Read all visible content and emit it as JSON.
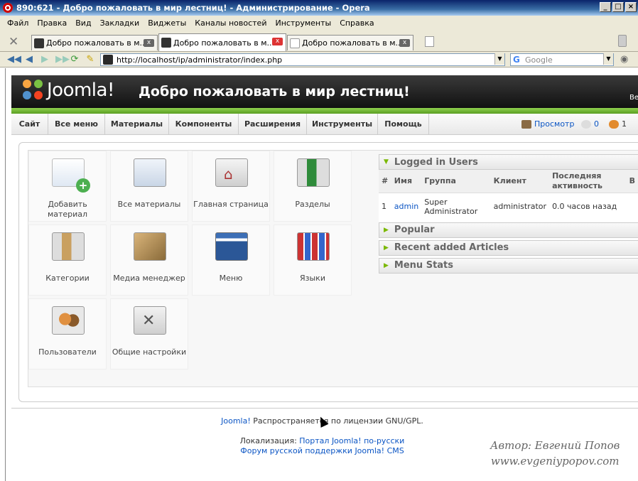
{
  "window": {
    "title": "890:621 - Добро пожаловать в мир лестниц! - Администрирование - Opera"
  },
  "browser_menu": [
    "Файл",
    "Правка",
    "Вид",
    "Закладки",
    "Виджеты",
    "Каналы новостей",
    "Инструменты",
    "Справка"
  ],
  "tabs": [
    {
      "label": "Добро пожаловать в м..."
    },
    {
      "label": "Добро пожаловать в м..."
    },
    {
      "label": "Добро пожаловать в м..."
    }
  ],
  "address": {
    "url": "http://localhost/ip/administrator/index.php",
    "search_placeholder": "Google"
  },
  "header": {
    "logo": "Joomla!",
    "title": "Добро пожаловать в мир лестниц!",
    "right_text": "Ве"
  },
  "main_menu": [
    "Сайт",
    "Все меню",
    "Материалы",
    "Компоненты",
    "Расширения",
    "Инструменты",
    "Помощь"
  ],
  "status": {
    "preview": "Просмотр",
    "messages": "0",
    "users": "1"
  },
  "cpanel": [
    {
      "label": "Добавить материал",
      "icon": "add-article-icon"
    },
    {
      "label": "Все материалы",
      "icon": "articles-icon"
    },
    {
      "label": "Главная страница",
      "icon": "frontpage-icon"
    },
    {
      "label": "Разделы",
      "icon": "sections-icon"
    },
    {
      "label": "Категории",
      "icon": "categories-icon"
    },
    {
      "label": "Медиа менеджер",
      "icon": "media-icon"
    },
    {
      "label": "Меню",
      "icon": "menu-icon"
    },
    {
      "label": "Языки",
      "icon": "languages-icon"
    },
    {
      "label": "Пользователи",
      "icon": "users-icon"
    },
    {
      "label": "Общие настройки",
      "icon": "config-icon"
    }
  ],
  "logged_users": {
    "title": "Logged in Users",
    "columns": [
      "#",
      "Имя",
      "Группа",
      "Клиент",
      "Последняя активность",
      "В"
    ],
    "rows": [
      {
        "num": "1",
        "name": "admin",
        "group": "Super Administrator",
        "client": "administrator",
        "activity": "0.0 часов назад"
      }
    ]
  },
  "accordion": [
    "Popular",
    "Recent added Articles",
    "Menu Stats"
  ],
  "footer": {
    "joomla": "Joomla!",
    "license": " Распространяется по лицензии GNU/GPL.",
    "loc_label": "Локализация: ",
    "loc_link": "Портал Joomla! по-русски",
    "forum": "Форум русской поддержки Joomla! CMS"
  },
  "signature": {
    "line1": "Автор: Евгений Попов",
    "line2": "www.evgeniypopov.com"
  }
}
